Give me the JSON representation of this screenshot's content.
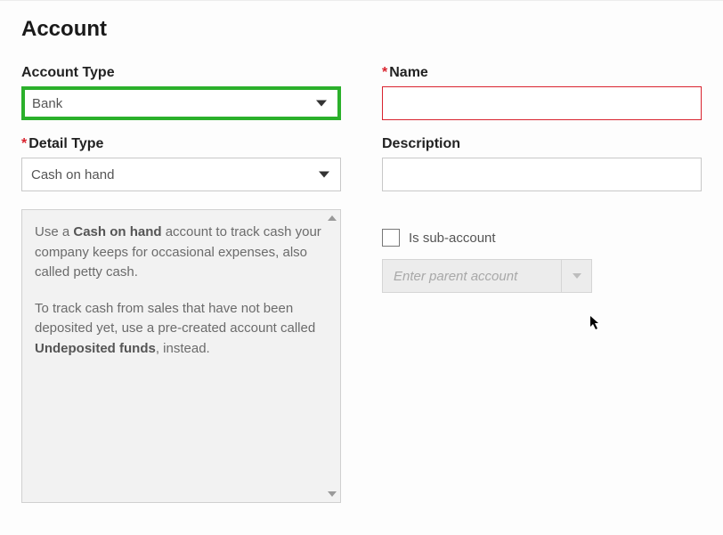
{
  "title": "Account",
  "left": {
    "account_type_label": "Account Type",
    "account_type_value": "Bank",
    "detail_type_label": "Detail Type",
    "detail_type_value": "Cash on hand",
    "info_pre": "Use a ",
    "info_bold1": "Cash on hand",
    "info_mid1": " account to track cash your company keeps for occasional expenses, also called petty cash.",
    "info_p2_pre": "To track cash from sales that have not been deposited yet, use a pre-created account called ",
    "info_bold2": "Undeposited funds",
    "info_p2_post": ", instead."
  },
  "right": {
    "name_label": "Name",
    "name_value": "",
    "description_label": "Description",
    "description_value": "",
    "sub_label": "Is sub-account",
    "parent_placeholder": "Enter parent account"
  }
}
